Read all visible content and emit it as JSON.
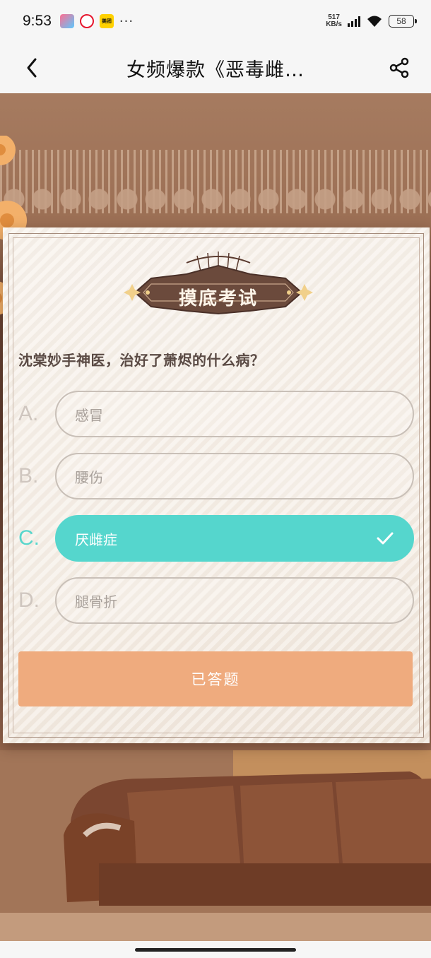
{
  "status_bar": {
    "time": "9:53",
    "app_icons": [
      "ticket-app-icon",
      "weibo-icon",
      "meituan-icon"
    ],
    "meituan_label": "美团",
    "more": "···",
    "net_speed_value": "517",
    "net_speed_unit": "KB/s",
    "battery": "58"
  },
  "nav": {
    "title": "女频爆款《恶毒雌…",
    "back_icon": "chevron-left-icon",
    "share_icon": "share-icon"
  },
  "quiz": {
    "badge_title": "摸底考试",
    "question": "沈棠妙手神医，治好了萧烬的什么病？",
    "options": [
      {
        "letter": "A.",
        "text": "感冒",
        "selected": false
      },
      {
        "letter": "B.",
        "text": "腰伤",
        "selected": false
      },
      {
        "letter": "C.",
        "text": "厌雌症",
        "selected": true
      },
      {
        "letter": "D.",
        "text": "腿骨折",
        "selected": false
      }
    ],
    "submit_label": "已答题"
  },
  "colors": {
    "selected": "#55d6cd",
    "submit": "#efab7e",
    "badge": "#6b4a3c"
  }
}
